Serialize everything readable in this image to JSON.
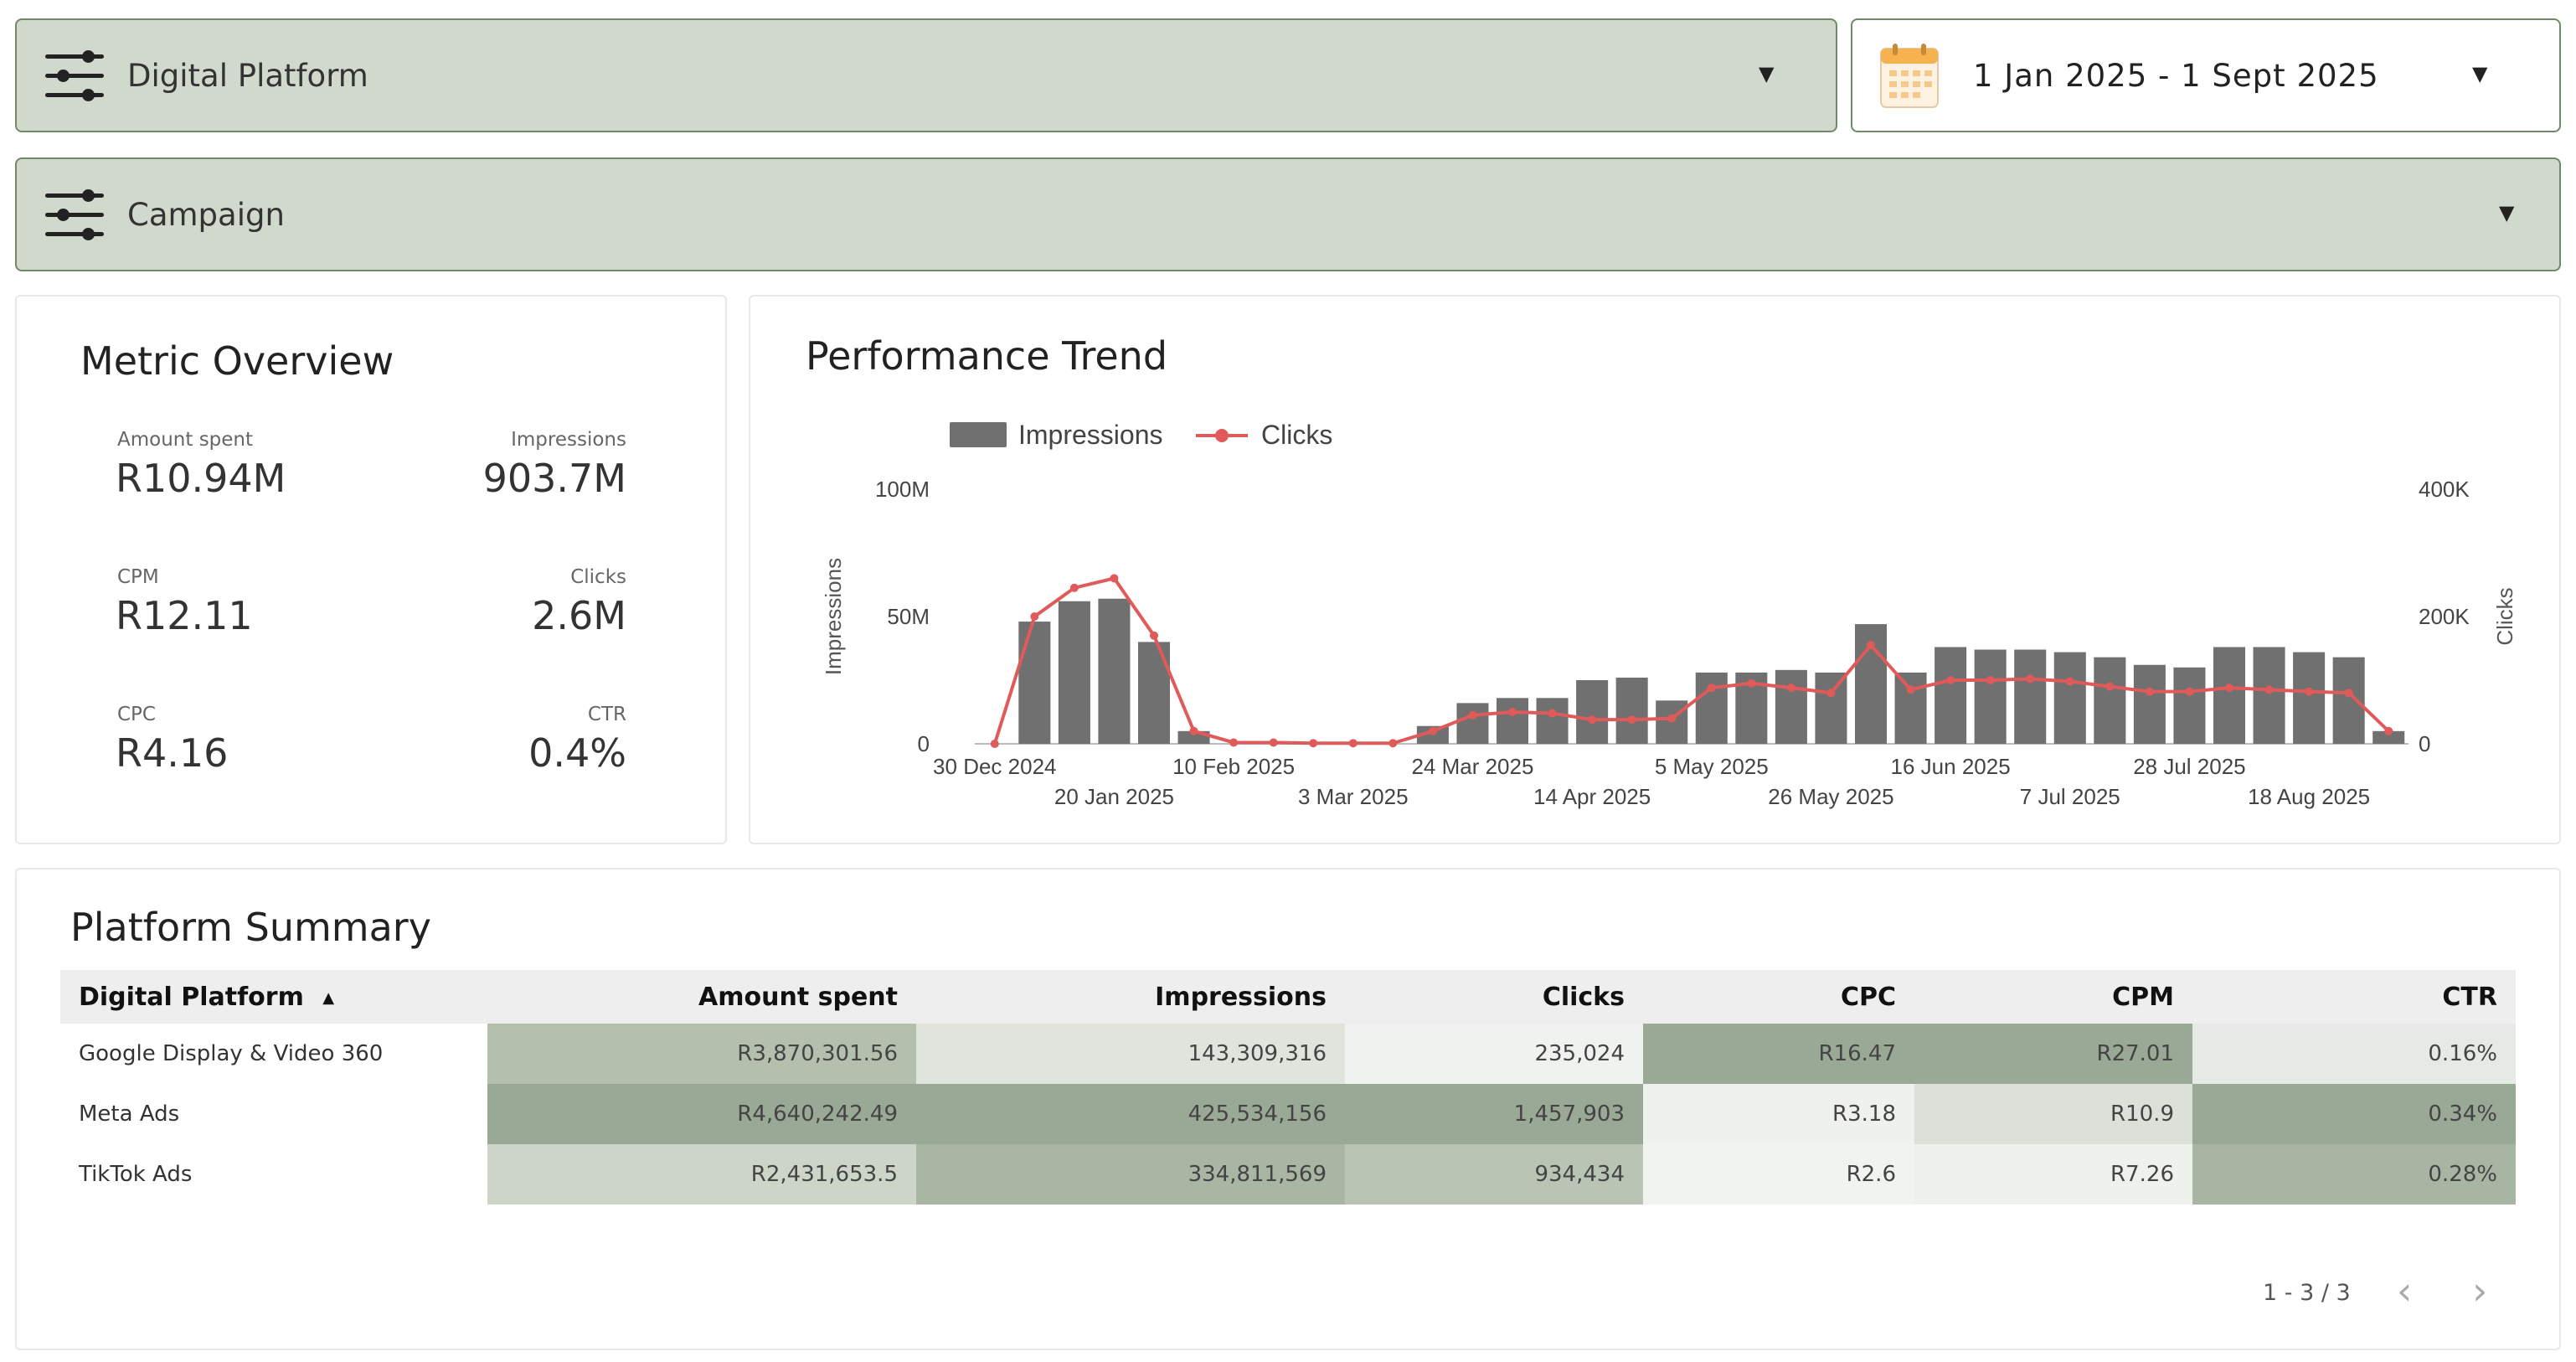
{
  "filters": {
    "platform_label": "Digital Platform",
    "campaign_label": "Campaign",
    "date_range": "1 Jan 2025 - 1 Sept 2025"
  },
  "colors": {
    "accent": "#d0d9cc",
    "border": "#6f8a66",
    "bar": "#707070",
    "line": "#e05a5a"
  },
  "icons": {
    "filter": "sliders-icon",
    "calendar": "calendar-icon",
    "caret": "caret-down-icon"
  },
  "metrics": {
    "title": "Metric Overview",
    "items": [
      {
        "label": "Amount spent",
        "value": "R10.94M"
      },
      {
        "label": "Impressions",
        "value": "903.7M"
      },
      {
        "label": "CPM",
        "value": "R12.11"
      },
      {
        "label": "Clicks",
        "value": "2.6M"
      },
      {
        "label": "CPC",
        "value": "R4.16"
      },
      {
        "label": "CTR",
        "value": "0.4%"
      }
    ]
  },
  "chart_data": {
    "type": "bar",
    "title": "Performance Trend",
    "legend": [
      "Impressions",
      "Clicks"
    ],
    "legend_position": "top-left",
    "ylabel_left": "Impressions",
    "ylabel_right": "Clicks",
    "left_ticks": [
      "0",
      "50M",
      "100M"
    ],
    "right_ticks": [
      "0",
      "200K",
      "400K"
    ],
    "ylim_left": [
      0,
      100000000
    ],
    "ylim_right": [
      0,
      400000
    ],
    "x_ticks_row1": [
      "30 Dec 2024",
      "10 Feb 2025",
      "24 Mar 2025",
      "5 May 2025",
      "16 Jun 2025",
      "28 Jul 2025"
    ],
    "x_ticks_row2": [
      "20 Jan 2025",
      "3 Mar 2025",
      "14 Apr 2025",
      "26 May 2025",
      "7 Jul 2025",
      "18 Aug 2025"
    ],
    "series": [
      {
        "name": "Impressions",
        "type": "bar",
        "values": [
          0,
          48000000,
          56000000,
          57000000,
          40000000,
          5000000,
          0,
          0,
          0,
          0,
          0,
          7000000,
          16000000,
          18000000,
          18000000,
          25000000,
          26000000,
          17000000,
          28000000,
          28000000,
          29000000,
          28000000,
          47000000,
          28000000,
          38000000,
          37000000,
          37000000,
          36000000,
          34000000,
          31000000,
          30000000,
          38000000,
          38000000,
          36000000,
          34000000,
          5000000
        ]
      },
      {
        "name": "Clicks",
        "type": "line",
        "values": [
          0,
          200000,
          245000,
          260000,
          170000,
          20000,
          2000,
          2000,
          1000,
          1000,
          1000,
          20000,
          45000,
          50000,
          48000,
          38000,
          38000,
          40000,
          88000,
          95000,
          88000,
          80000,
          155000,
          85000,
          100000,
          100000,
          102000,
          98000,
          90000,
          82000,
          82000,
          88000,
          85000,
          82000,
          80000,
          20000
        ]
      }
    ]
  },
  "summary": {
    "title": "Platform Summary",
    "headers": [
      "Digital Platform",
      "Amount spent",
      "Impressions",
      "Clicks",
      "CPC",
      "CPM",
      "CTR"
    ],
    "sort_indicator": "▲",
    "rows": [
      [
        "Google Display & Video 360",
        "R3,870,301.56",
        "143,309,316",
        "235,024",
        "R16.47",
        "R27.01",
        "0.16%"
      ],
      [
        "Meta Ads",
        "R4,640,242.49",
        "425,534,156",
        "1,457,903",
        "R3.18",
        "R10.9",
        "0.34%"
      ],
      [
        "TikTok Ads",
        "R2,431,653.5",
        "334,811,569",
        "934,434",
        "R2.6",
        "R7.26",
        "0.28%"
      ]
    ],
    "pager": "1 - 3 / 3",
    "prev": "‹",
    "next": "›"
  }
}
